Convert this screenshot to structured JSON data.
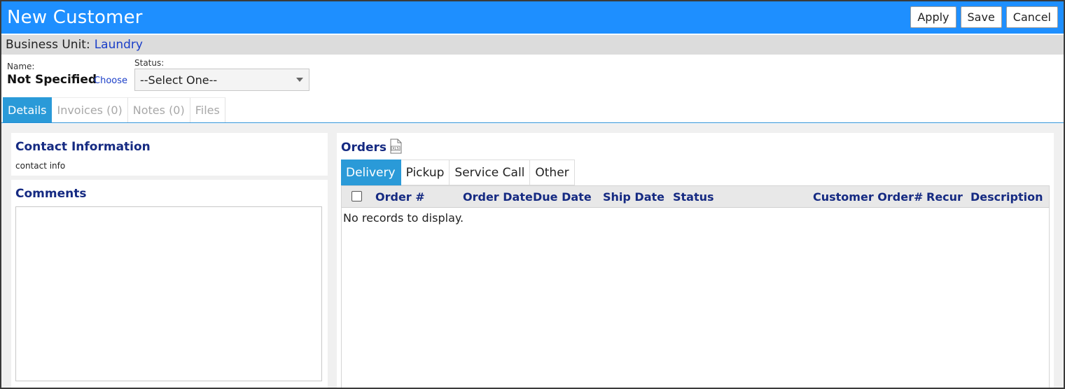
{
  "window": {
    "title": "New Customer"
  },
  "toolbar": {
    "apply_label": "Apply",
    "save_label": "Save",
    "cancel_label": "Cancel"
  },
  "business_unit": {
    "label": "Business Unit:",
    "value": "Laundry"
  },
  "name_field": {
    "label": "Name:",
    "value": "Not Specified",
    "choose_label": "Choose"
  },
  "status_field": {
    "label": "Status:",
    "selected": "--Select One--"
  },
  "main_tabs": [
    {
      "label": "Details",
      "active": true
    },
    {
      "label": "Invoices (0)",
      "active": false
    },
    {
      "label": "Notes (0)",
      "active": false
    },
    {
      "label": "Files",
      "active": false
    }
  ],
  "contact": {
    "title": "Contact Information",
    "text": "contact info"
  },
  "comments": {
    "title": "Comments"
  },
  "orders": {
    "title": "Orders",
    "export_icon": "xls-file-icon",
    "tabs": [
      {
        "label": "Delivery",
        "active": true
      },
      {
        "label": "Pickup",
        "active": false
      },
      {
        "label": "Service Call",
        "active": false
      },
      {
        "label": "Other",
        "active": false
      }
    ],
    "columns": [
      "Order #",
      "Order Date",
      "Due Date",
      "Ship Date",
      "Status",
      "Customer Order#",
      "Recur",
      "Description"
    ],
    "empty_message": "No records to display."
  },
  "colors": {
    "header_blue": "#1e8fff",
    "tab_active": "#2a9ad8",
    "heading_navy": "#152a82",
    "link_blue": "#1a3ec8"
  }
}
